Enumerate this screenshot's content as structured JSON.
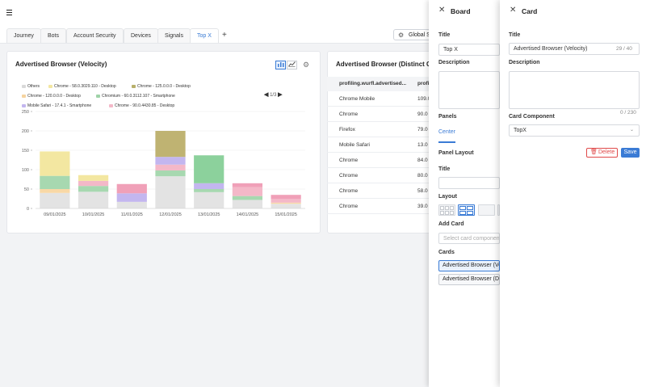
{
  "tabs": [
    {
      "label": "Journey"
    },
    {
      "label": "Bots"
    },
    {
      "label": "Account Security"
    },
    {
      "label": "Devices"
    },
    {
      "label": "Signals"
    },
    {
      "label": "Top X"
    }
  ],
  "global_button": {
    "label": "Global S"
  },
  "velocity_card": {
    "title": "Advertised Browser (Velocity)",
    "legend": [
      {
        "name": "Others",
        "color": "#d9d9d9"
      },
      {
        "name": "Chrome - 58.0.3029.110 - Desktop",
        "color": "#f3e7a1"
      },
      {
        "name": "Chrome - 125.0.0.0 - Desktop",
        "color": "#b8b06b"
      },
      {
        "name": "Chrome - 120.0.0.0 - Desktop",
        "color": "#f6d4a0"
      },
      {
        "name": "Chromium - 60.0.3112.107 - Smartphone",
        "color": "#9fd3a8"
      },
      {
        "name": "Mobile Safari - 17.4.1 - Smartphone",
        "color": "#c3b6ef"
      },
      {
        "name": "Chrome - 90.0.4430.85 - Desktop",
        "color": "#f4b8c8"
      }
    ],
    "legend_pager": "1/3"
  },
  "chart_data": {
    "type": "bar",
    "stacked": true,
    "categories": [
      "09/01/2025",
      "10/01/2025",
      "11/01/2025",
      "12/01/2025",
      "13/01/2025",
      "14/01/2025",
      "15/01/2025"
    ],
    "series": [
      {
        "name": "Others",
        "color": "#e3e3e3",
        "values": [
          40,
          43,
          17,
          83,
          42,
          22,
          12
        ]
      },
      {
        "name": "Chrome - 120.0.0.0 - Desktop",
        "color": "#f8d8a6",
        "values": [
          10,
          0,
          0,
          0,
          0,
          0,
          3
        ]
      },
      {
        "name": "Chromium - 60.0.3112.107 - Smartphone",
        "color": "#a7d8b0",
        "values": [
          34,
          15,
          0,
          15,
          8,
          10,
          0
        ]
      },
      {
        "name": "Chrome - 90.0.4430.85 - Desktop",
        "color": "#f4b8c8",
        "values": [
          0,
          13,
          0,
          15,
          0,
          23,
          10
        ]
      },
      {
        "name": "Mobile Safari - 17.4.1 - Smartphone",
        "color": "#c3b6ef",
        "values": [
          0,
          0,
          22,
          20,
          15,
          0,
          0
        ]
      },
      {
        "name": "Chrome - 125.0.0.0 - Desktop",
        "color": "#bfb372",
        "values": [
          0,
          0,
          0,
          67,
          0,
          0,
          0
        ]
      },
      {
        "name": "Chrome - 58.0.3029.110 - Desktop",
        "color": "#f3e7a1",
        "values": [
          63,
          15,
          0,
          0,
          0,
          0,
          0
        ]
      },
      {
        "name": "Chrome - 125.0.0.0 - Desktop (top)",
        "color": "#f0a0b8",
        "values": [
          0,
          0,
          24,
          0,
          0,
          10,
          10
        ]
      },
      {
        "name": "Chrome - 58.0.3029.110 - Desktop (top)",
        "color": "#8cd19c",
        "values": [
          0,
          0,
          0,
          0,
          72,
          0,
          0
        ]
      }
    ],
    "yticks": [
      0,
      50,
      100,
      150,
      200,
      250
    ],
    "ylim": [
      0,
      250
    ]
  },
  "distinct_card": {
    "title": "Advertised Browser (Distinct Co",
    "columns": [
      "profiling.wurfl.advertised...",
      "profi"
    ],
    "rows": [
      {
        "name": "Chrome Mobile",
        "value": "109.0"
      },
      {
        "name": "Chrome",
        "value": "90.0"
      },
      {
        "name": "Firefox",
        "value": "79.0"
      },
      {
        "name": "Mobile Safari",
        "value": "13.0"
      },
      {
        "name": "Chrome",
        "value": "84.0"
      },
      {
        "name": "Chrome",
        "value": "80.0"
      },
      {
        "name": "Chrome",
        "value": "58.0"
      },
      {
        "name": "Chrome",
        "value": "39.0"
      }
    ]
  },
  "board_panel": {
    "title": "Board",
    "title_label": "Title",
    "title_value": "Top X",
    "description_label": "Description",
    "panels_label": "Panels",
    "panel_tab": "Center",
    "panel_layout_label": "Panel Layout",
    "layout_title_label": "Title",
    "layout_label": "Layout",
    "add_card_label": "Add Card",
    "add_card_placeholder": "Select card componen",
    "cards_label": "Cards",
    "cards": [
      "Advertised Browser (Ve",
      "Advertised Browser (Di"
    ]
  },
  "card_panel": {
    "title": "Card",
    "title_label": "Title",
    "title_value": "Advertised Browser (Velocity)",
    "title_counter": "29 / 40",
    "description_label": "Description",
    "description_value": "",
    "description_counter": "0 / 230",
    "component_label": "Card Component",
    "component_value": "TopX",
    "delete_label": "Delete",
    "save_label": "Save"
  }
}
